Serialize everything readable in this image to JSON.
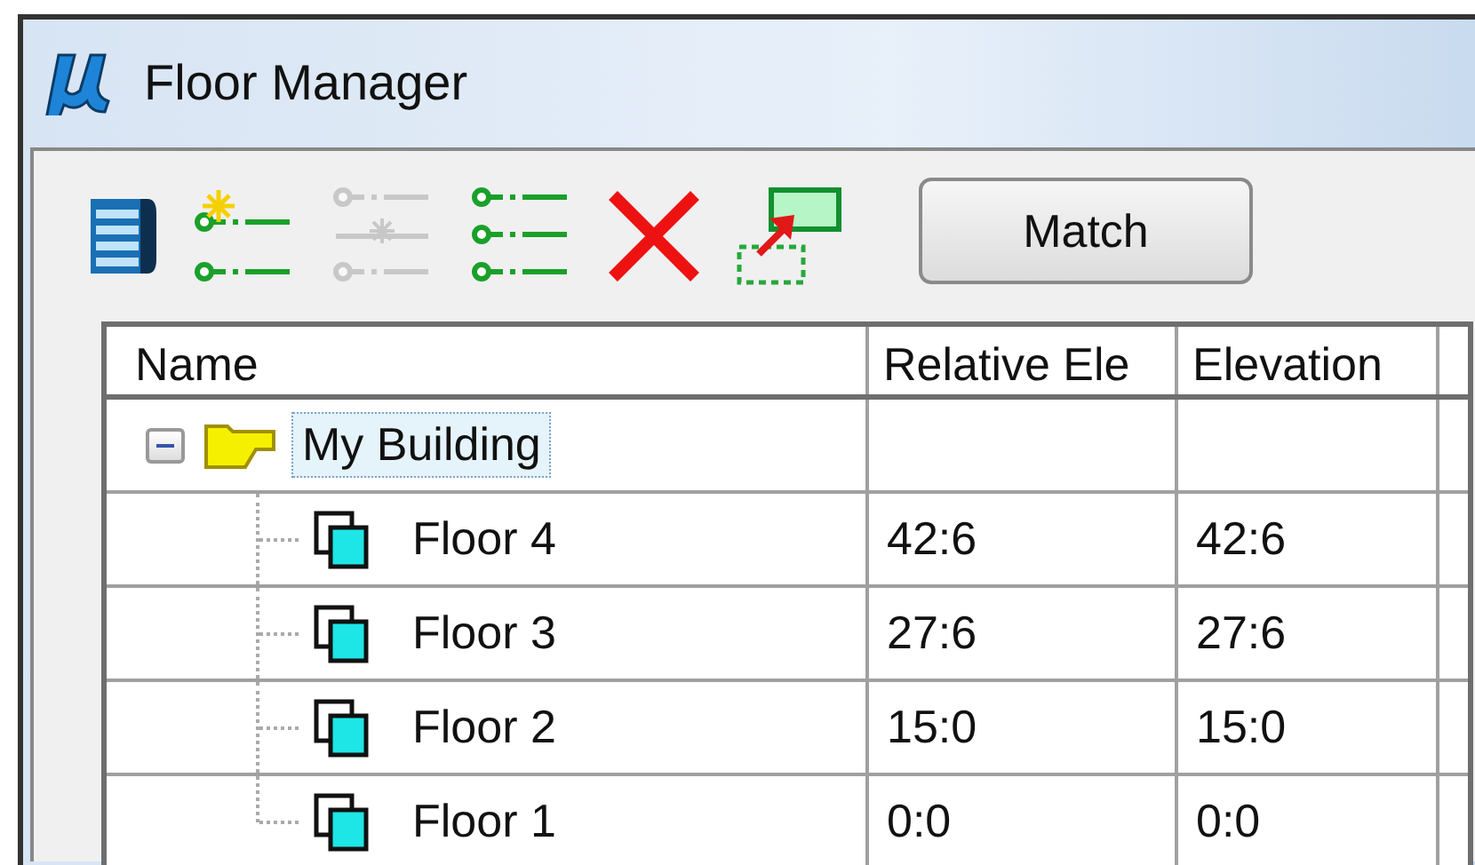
{
  "window": {
    "title": "Floor Manager"
  },
  "toolbar": {
    "tools": [
      {
        "kind": "list",
        "disabled": false
      },
      {
        "kind": "add",
        "disabled": false
      },
      {
        "kind": "insert",
        "disabled": true
      },
      {
        "kind": "nodes",
        "disabled": false
      },
      {
        "kind": "delete",
        "disabled": false
      },
      {
        "kind": "move",
        "disabled": false
      }
    ],
    "match_button": "Match"
  },
  "table": {
    "columns": [
      "Name",
      "Relative Ele",
      "Elevation"
    ],
    "rows": [
      {
        "kind": "building",
        "name": "My Building",
        "selected": true,
        "expanded": true,
        "children": [
          {
            "kind": "floor",
            "name": "Floor 4",
            "selected": false,
            "relative_elevation": "42:6",
            "elevation": "42:6"
          },
          {
            "kind": "floor",
            "name": "Floor 3",
            "selected": false,
            "relative_elevation": "27:6",
            "elevation": "27:6"
          },
          {
            "kind": "floor",
            "name": "Floor 2",
            "selected": false,
            "relative_elevation": "15:0",
            "elevation": "15:0"
          },
          {
            "kind": "floor",
            "name": "Floor 1",
            "selected": false,
            "relative_elevation": "0:0",
            "elevation": "0:0"
          }
        ]
      }
    ]
  }
}
